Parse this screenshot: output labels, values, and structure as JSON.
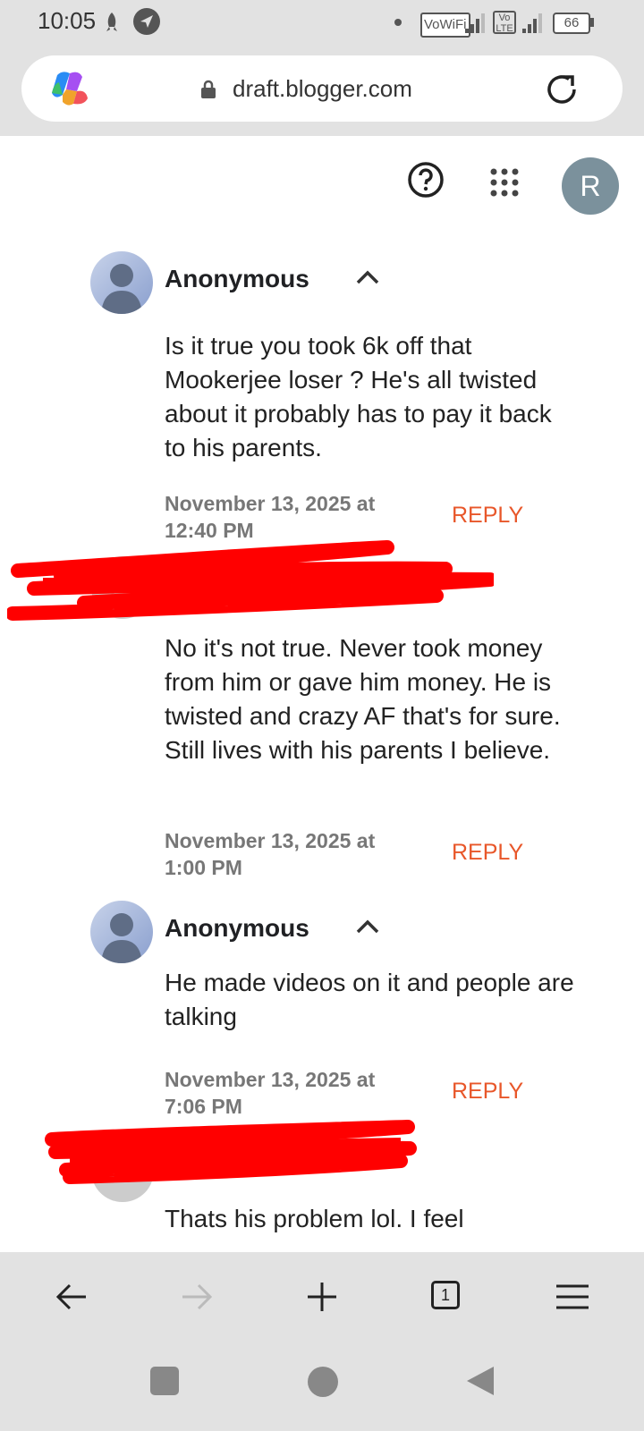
{
  "status_bar": {
    "time": "10:05",
    "vowifi": "VoWiFi",
    "volte": "Vo LTE",
    "battery": "66"
  },
  "browser": {
    "url": "draft.blogger.com"
  },
  "header": {
    "account_initial": "R"
  },
  "comments": [
    {
      "author": "Anonymous",
      "text": "Is it true you took 6k off that Mookerjee loser ? He's all twisted about it probably has to pay it back to his parents.",
      "date": "November 13, 2025 at 12:40 PM",
      "reply_label": "REPLY"
    },
    {
      "author": "",
      "text": "No it's not true. Never took money from him or gave him money. He is twisted and crazy AF that's for sure. Still lives with his parents I believe.",
      "date": "November 13, 2025 at 1:00 PM",
      "reply_label": "REPLY"
    },
    {
      "author": "Anonymous",
      "text": "He made videos on it and people are talking",
      "date": "November 13, 2025 at 7:06 PM",
      "reply_label": "REPLY"
    },
    {
      "author": "",
      "text": "Thats his problem lol. I feel",
      "date": "",
      "reply_label": ""
    }
  ],
  "bottom_nav": {
    "tab_count": "1"
  },
  "colors": {
    "reply": "#e8572a",
    "redaction": "#ff0000",
    "avatar_bg": "#7b919c"
  }
}
